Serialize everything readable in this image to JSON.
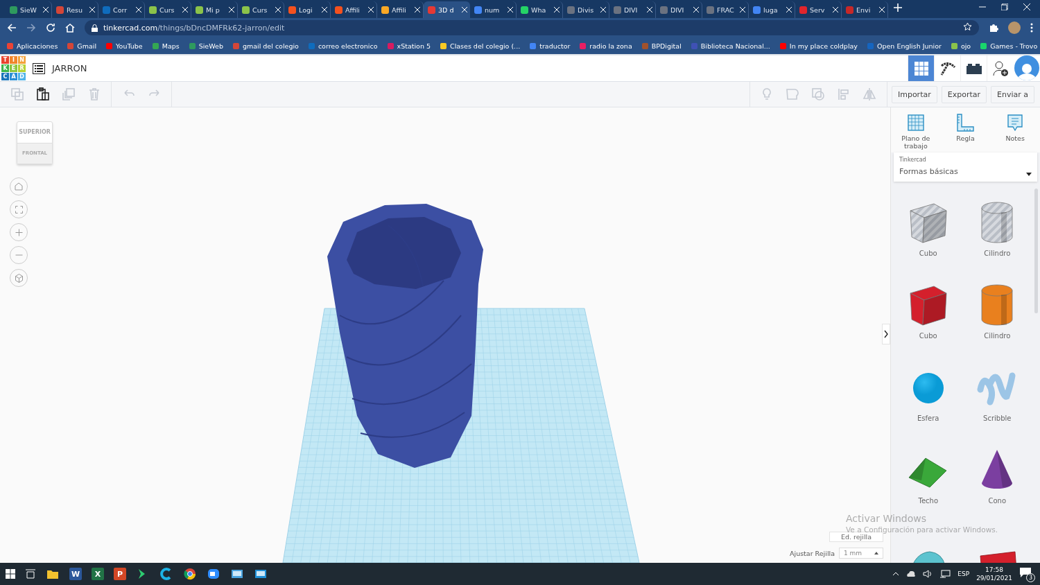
{
  "browser": {
    "tabs": [
      {
        "title": "SieW",
        "color": "#2e9a5e",
        "selected": false
      },
      {
        "title": "Resu",
        "color": "#d44638",
        "selected": false
      },
      {
        "title": "Corr",
        "color": "#0f6cbd",
        "selected": false
      },
      {
        "title": "Curs",
        "color": "#8bc34a",
        "selected": false
      },
      {
        "title": "Mi p",
        "color": "#8bc34a",
        "selected": false
      },
      {
        "title": "Curs",
        "color": "#8bc34a",
        "selected": false
      },
      {
        "title": "Logi",
        "color": "#f4511e",
        "selected": false
      },
      {
        "title": "Affili",
        "color": "#f4511e",
        "selected": false
      },
      {
        "title": "Affili",
        "color": "#f9a825",
        "selected": false
      },
      {
        "title": "3D d",
        "color": "#e53935",
        "selected": true
      },
      {
        "title": "num",
        "color": "#4285f4",
        "selected": false
      },
      {
        "title": "Wha",
        "color": "#25d366",
        "selected": false
      },
      {
        "title": "Divis",
        "color": "#6b7280",
        "selected": false
      },
      {
        "title": "DIVI",
        "color": "#6b7280",
        "selected": false
      },
      {
        "title": "DIVI",
        "color": "#6b7280",
        "selected": false
      },
      {
        "title": "FRAC",
        "color": "#6b7280",
        "selected": false
      },
      {
        "title": "luga",
        "color": "#4285f4",
        "selected": false
      },
      {
        "title": "Serv",
        "color": "#e0252c",
        "selected": false
      },
      {
        "title": "Envi",
        "color": "#c62828",
        "selected": false
      }
    ],
    "address": {
      "domain": "tinkercad.com",
      "path": "/things/bDncDMFRk62-jarron/edit"
    },
    "bookmarks": [
      {
        "label": "Aplicaciones",
        "color": "#ea4335"
      },
      {
        "label": "Gmail",
        "color": "#d44638"
      },
      {
        "label": "YouTube",
        "color": "#ff0000"
      },
      {
        "label": "Maps",
        "color": "#34a853"
      },
      {
        "label": "SieWeb",
        "color": "#2e9a5e"
      },
      {
        "label": "gmail del colegio",
        "color": "#d44638"
      },
      {
        "label": "correo electronico",
        "color": "#0f6cbd"
      },
      {
        "label": "xStation 5",
        "color": "#d81b60"
      },
      {
        "label": "Clases del colegio (...",
        "color": "#f9ca24"
      },
      {
        "label": "traductor",
        "color": "#4285f4"
      },
      {
        "label": "radio la zona",
        "color": "#e91e63"
      },
      {
        "label": "BPDigital",
        "color": "#a0522d"
      },
      {
        "label": "Biblioteca Nacional...",
        "color": "#3f51b5"
      },
      {
        "label": "In my place coldplay",
        "color": "#ff0000"
      },
      {
        "label": "Open English Junior",
        "color": "#1565c0"
      },
      {
        "label": "ojo",
        "color": "#8bc34a"
      },
      {
        "label": "Games - Trovo",
        "color": "#19d66b"
      }
    ]
  },
  "app": {
    "logo_letters": [
      {
        "letter": "T",
        "color": "#e8432e"
      },
      {
        "letter": "I",
        "color": "#f0862a"
      },
      {
        "letter": "N",
        "color": "#f3a23a"
      },
      {
        "letter": "K",
        "color": "#3cb54a"
      },
      {
        "letter": "E",
        "color": "#8cc63f"
      },
      {
        "letter": "R",
        "color": "#b5d334"
      },
      {
        "letter": "C",
        "color": "#1b75bb"
      },
      {
        "letter": "A",
        "color": "#2b8fd6"
      },
      {
        "letter": "D",
        "color": "#4fb3e8"
      }
    ],
    "design_title": "JARRON",
    "view_buttons": [
      {
        "kind": "grid",
        "selected": true
      },
      {
        "kind": "pickaxe",
        "selected": false
      },
      {
        "kind": "bricks",
        "selected": false
      }
    ],
    "edit_tools": [
      {
        "kind": "copy",
        "disabled": true
      },
      {
        "kind": "paste",
        "disabled": false
      },
      {
        "kind": "duplicate",
        "disabled": true
      },
      {
        "kind": "delete",
        "disabled": true
      },
      {
        "kind": "undo",
        "disabled": true
      },
      {
        "kind": "redo",
        "disabled": true
      }
    ],
    "shape_tools": [
      {
        "kind": "light",
        "disabled": true
      },
      {
        "kind": "solid",
        "disabled": true
      },
      {
        "kind": "hole",
        "disabled": true
      },
      {
        "kind": "align",
        "disabled": true
      },
      {
        "kind": "mirror",
        "disabled": true
      }
    ],
    "actions": [
      "Importar",
      "Exportar",
      "Enviar a"
    ]
  },
  "canvas": {
    "view_cube": {
      "top": "SUPERIOR",
      "front": "FRONTAL"
    },
    "grid_edit": "Ed. rejilla",
    "snap_label": "Ajustar Rejilla",
    "snap_value": "1 mm"
  },
  "panel": {
    "tools": [
      {
        "kind": "workplane",
        "label": "Plano de trabajo"
      },
      {
        "kind": "ruler",
        "label": "Regla"
      },
      {
        "kind": "notes",
        "label": "Notes"
      }
    ],
    "library_label": "Tinkercad",
    "library": "Formas básicas",
    "shapes": [
      {
        "kind": "cube",
        "label": "Cubo",
        "hole": true,
        "color": "#c9cdd3"
      },
      {
        "kind": "cylinder",
        "label": "Cilindro",
        "hole": true,
        "color": "#c9cdd3"
      },
      {
        "kind": "cube",
        "label": "Cubo",
        "hole": false,
        "color": "#d4202c"
      },
      {
        "kind": "cylinder",
        "label": "Cilindro",
        "hole": false,
        "color": "#e9801e"
      },
      {
        "kind": "sphere",
        "label": "Esfera",
        "hole": false,
        "color": "#0a9bd6"
      },
      {
        "kind": "scribble",
        "label": "Scribble",
        "hole": false,
        "color": "#9cc5e6"
      },
      {
        "kind": "roof",
        "label": "Techo",
        "hole": false,
        "color": "#3aa83a"
      },
      {
        "kind": "cone",
        "label": "Cono",
        "hole": false,
        "color": "#7b3fa0"
      },
      {
        "kind": "halfcylinder",
        "hole": false,
        "color": "#5cc3cf"
      },
      {
        "kind": "text",
        "hole": false,
        "color": "#d4202c"
      }
    ]
  },
  "windows_notice": {
    "title": "Activar Windows",
    "text": "Ve a Configuración para activar Windows."
  },
  "taskbar": {
    "apps": [
      {
        "kind": "explorer"
      },
      {
        "kind": "word",
        "glyph": "W"
      },
      {
        "kind": "excel",
        "glyph": "X"
      },
      {
        "kind": "powerpoint",
        "glyph": "P"
      },
      {
        "kind": "arrow"
      },
      {
        "kind": "ccleaner"
      },
      {
        "kind": "chrome"
      },
      {
        "kind": "zoom"
      },
      {
        "kind": "screen"
      },
      {
        "kind": "app"
      }
    ],
    "language": "ESP",
    "time": "17:58",
    "date": "29/01/2021",
    "notifications": "3"
  }
}
